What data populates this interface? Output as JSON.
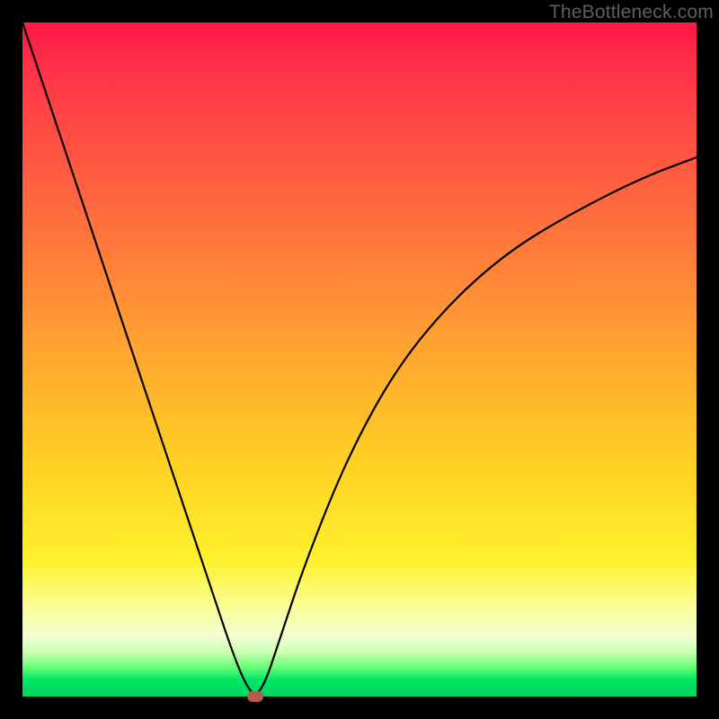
{
  "watermark": {
    "text": "TheBottleneck.com"
  },
  "colors": {
    "curve": "#000000",
    "marker": "#b55a4c",
    "gradient_stops": [
      "#ff1845",
      "#ff6b3e",
      "#ffd223",
      "#fbfc8d",
      "#00d45e"
    ]
  },
  "chart_data": {
    "type": "line",
    "title": "",
    "xlabel": "",
    "ylabel": "",
    "xlim": [
      0,
      100
    ],
    "ylim": [
      0,
      100
    ],
    "series": [
      {
        "name": "bottleneck-curve",
        "x": [
          0,
          4,
          8,
          12,
          16,
          20,
          24,
          28,
          31,
          33,
          34.5,
          36,
          38,
          42,
          48,
          55,
          63,
          72,
          82,
          92,
          100
        ],
        "y": [
          100,
          88,
          76,
          64,
          52,
          40,
          28,
          16,
          7,
          2,
          0,
          2,
          8,
          20,
          35,
          48,
          58,
          66,
          72,
          77,
          80
        ]
      }
    ],
    "marker": {
      "x": 34.5,
      "y": 0,
      "label": ""
    },
    "grid": false,
    "legend": false
  }
}
